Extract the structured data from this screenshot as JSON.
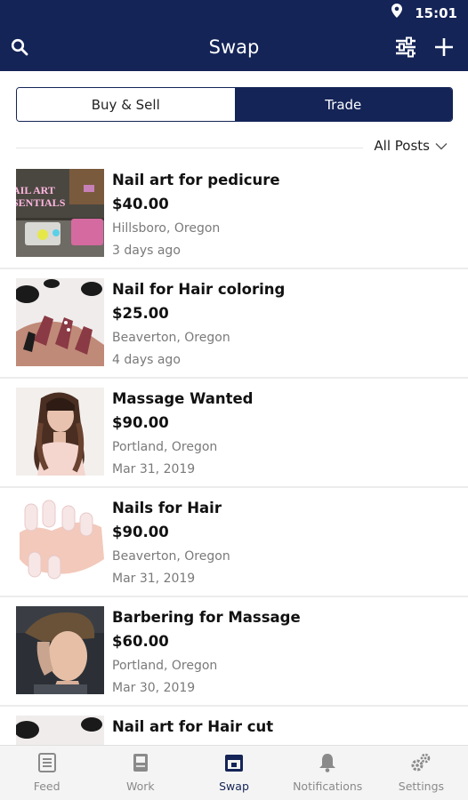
{
  "status": {
    "time": "15:01"
  },
  "appbar": {
    "title": "Swap",
    "search_icon": "search-icon",
    "filter_icon": "sliders-icon",
    "add_icon": "plus-icon"
  },
  "segment": {
    "buy_sell": "Buy & Sell",
    "trade": "Trade",
    "active": "trade"
  },
  "filter": {
    "label": "All Posts"
  },
  "listings": [
    {
      "title": "Nail art for pedicure",
      "price": "$40.00",
      "location": "Hillsboro, Oregon",
      "date": "3 days ago",
      "thumb_text_1": "AIL ART",
      "thumb_text_2": "SENTIALS"
    },
    {
      "title": "Nail for Hair coloring",
      "price": "$25.00",
      "location": "Beaverton, Oregon",
      "date": "4 days ago"
    },
    {
      "title": "Massage Wanted",
      "price": "$90.00",
      "location": "Portland, Oregon",
      "date": "Mar 31, 2019"
    },
    {
      "title": "Nails for Hair",
      "price": "$90.00",
      "location": "Beaverton, Oregon",
      "date": "Mar 31, 2019"
    },
    {
      "title": "Barbering for Massage",
      "price": "$60.00",
      "location": "Portland, Oregon",
      "date": "Mar 30, 2019"
    },
    {
      "title": "Nail art for Hair cut",
      "price": "",
      "location": "",
      "date": ""
    }
  ],
  "nav": {
    "feed": "Feed",
    "work": "Work",
    "swap": "Swap",
    "notifications": "Notifications",
    "settings": "Settings",
    "active": "swap"
  },
  "colors": {
    "primary": "#142457",
    "muted": "#7a7a7a",
    "nav_inactive": "#8a8a8a"
  }
}
